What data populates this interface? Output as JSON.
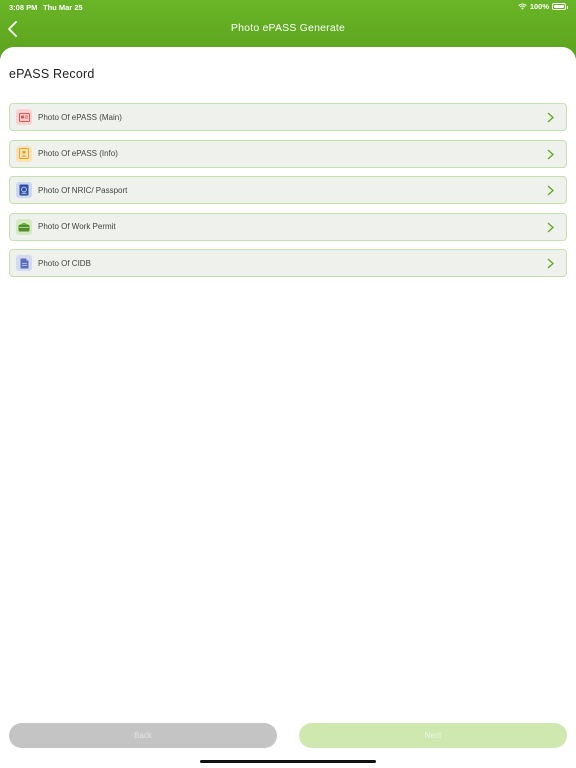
{
  "status_bar": {
    "time": "3:08 PM",
    "date": "Thu Mar 25",
    "battery": "100%"
  },
  "header": {
    "title": "Photo ePASS Generate"
  },
  "section": {
    "title": "ePASS Record"
  },
  "items": [
    {
      "label": "Photo Of ePASS (Main)",
      "icon": "id-card-icon",
      "icon_color": "#e8504a",
      "icon_bg": "#f8d3d1"
    },
    {
      "label": "Photo Of ePASS (Info)",
      "icon": "profile-card-icon",
      "icon_color": "#e3a320",
      "icon_bg": "#f9e4b8"
    },
    {
      "label": "Photo Of NRIC/ Passport",
      "icon": "passport-icon",
      "icon_color": "#2d4fa3",
      "icon_bg": "#cdd8f0"
    },
    {
      "label": "Photo Of Work Permit",
      "icon": "work-permit-icon",
      "icon_color": "#4e8f2a",
      "icon_bg": "#d5eac3"
    },
    {
      "label": "Photo Of CIDB",
      "icon": "document-icon",
      "icon_color": "#5a6fb8",
      "icon_bg": "#d4daf0"
    }
  ],
  "buttons": {
    "back": "Back",
    "next": "Next"
  },
  "colors": {
    "accent": "#5ea81f",
    "chevron": "#5ea81f"
  }
}
